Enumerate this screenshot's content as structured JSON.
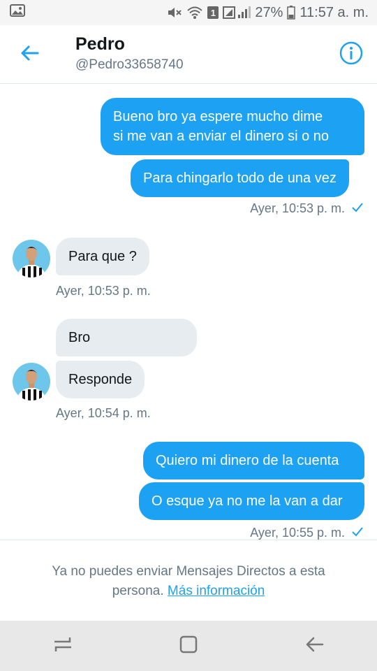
{
  "status_bar": {
    "battery_percent": "27%",
    "time": "11:57 a. m.",
    "sim_badge": "1",
    "icons": [
      "image-icon",
      "mute-icon",
      "wifi-icon",
      "sim-badge-icon",
      "signal-icon",
      "battery-icon"
    ]
  },
  "header": {
    "name": "Pedro",
    "handle": "@Pedro33658740",
    "back_icon": "back-arrow-icon",
    "info_icon": "info-icon"
  },
  "messages": {
    "m1": {
      "text_line1": "Bueno bro ya espere mucho dime",
      "text_line2": "si me van a enviar el dinero si o no"
    },
    "m2": {
      "text": "Para chingarlo todo de una vez"
    },
    "t1": {
      "text": "Ayer, 10:53 p. m."
    },
    "m3": {
      "text": "Para que ?"
    },
    "t2": {
      "text": "Ayer, 10:53 p. m."
    },
    "m4": {
      "text": "Bro"
    },
    "m5": {
      "text": "Responde"
    },
    "t3": {
      "text": "Ayer, 10:54 p. m."
    },
    "m6": {
      "text": "Quiero mi dinero de la cuenta"
    },
    "m7": {
      "text": "O esque ya no me la van a dar"
    },
    "t4": {
      "text": "Ayer, 10:55 p. m."
    }
  },
  "notice": {
    "line1": "Ya no puedes enviar Mensajes Directos a esta",
    "line2_prefix": "persona.",
    "link": "Más información"
  },
  "colors": {
    "accent": "#1da1f2",
    "incoming_bubble": "#e6ecf0",
    "secondary_text": "#657786"
  },
  "nav_bar": {
    "icons": [
      "recent-apps-icon",
      "home-icon",
      "back-icon"
    ]
  }
}
